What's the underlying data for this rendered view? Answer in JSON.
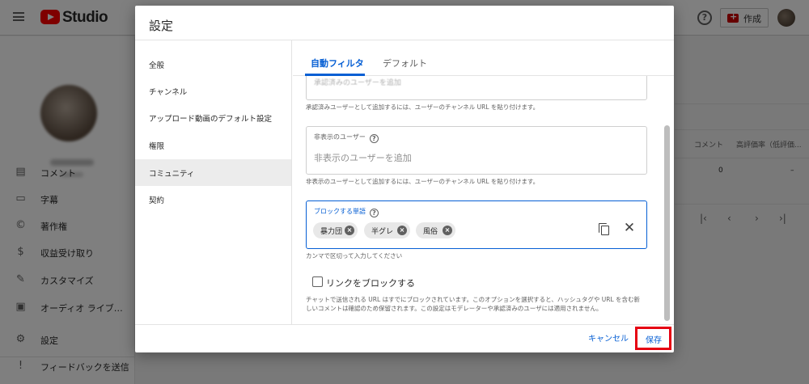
{
  "header": {
    "app_name": "Studio",
    "create_label": "作成"
  },
  "sidebar": {
    "items": [
      {
        "icon": "comment-icon",
        "label": "コメント"
      },
      {
        "icon": "subtitles-icon",
        "label": "字幕"
      },
      {
        "icon": "copyright-icon",
        "label": "著作権"
      },
      {
        "icon": "dollar-icon",
        "label": "収益受け取り"
      },
      {
        "icon": "magic-wand-icon",
        "label": "カスタマイズ"
      },
      {
        "icon": "audio-library-icon",
        "label": "オーディオ ライブ…"
      },
      {
        "icon": "gear-icon",
        "label": "設定"
      },
      {
        "icon": "feedback-icon",
        "label": "フィードバックを送信"
      }
    ]
  },
  "background_table": {
    "headers": [
      "コメント",
      "高評価率（低評価..."
    ],
    "values": [
      "0",
      "–"
    ]
  },
  "dialog": {
    "title": "設定",
    "menu": [
      {
        "label": "全般",
        "active": false
      },
      {
        "label": "チャンネル",
        "active": false
      },
      {
        "label": "アップロード動画のデフォルト設定",
        "active": false
      },
      {
        "label": "権限",
        "active": false
      },
      {
        "label": "コミュニティ",
        "active": true
      },
      {
        "label": "契約",
        "active": false
      }
    ],
    "tabs": [
      {
        "label": "自動フィルタ",
        "active": true
      },
      {
        "label": "デフォルト",
        "active": false
      }
    ],
    "approved_users": {
      "placeholder_partial": "承認済みのユーザーを追加",
      "hint": "承認済みユーザーとして追加するには、ユーザーのチャンネル URL を貼り付けます。"
    },
    "hidden_users": {
      "label": "非表示のユーザー",
      "placeholder": "非表示のユーザーを追加",
      "hint": "非表示のユーザーとして追加するには、ユーザーのチャンネル URL を貼り付けます。"
    },
    "blocked_words": {
      "label": "ブロックする単語",
      "chips": [
        "暴力団",
        "半グレ",
        "風俗"
      ],
      "hint": "カンマで区切って入力してください"
    },
    "block_links": {
      "label": "リンクをブロックする",
      "checked": false,
      "note": "チャットで送信される URL はすでにブロックされています。このオプションを選択すると、ハッシュタグや URL を含む新しいコメントは確認のため保留されます。この設定はモデレーターや承認済みのユーザには適用されません。"
    },
    "cancel_label": "キャンセル",
    "save_label": "保存"
  },
  "colors": {
    "accent": "#065fd4",
    "highlight_box": "#e60012",
    "brand_red": "#ff0000"
  }
}
